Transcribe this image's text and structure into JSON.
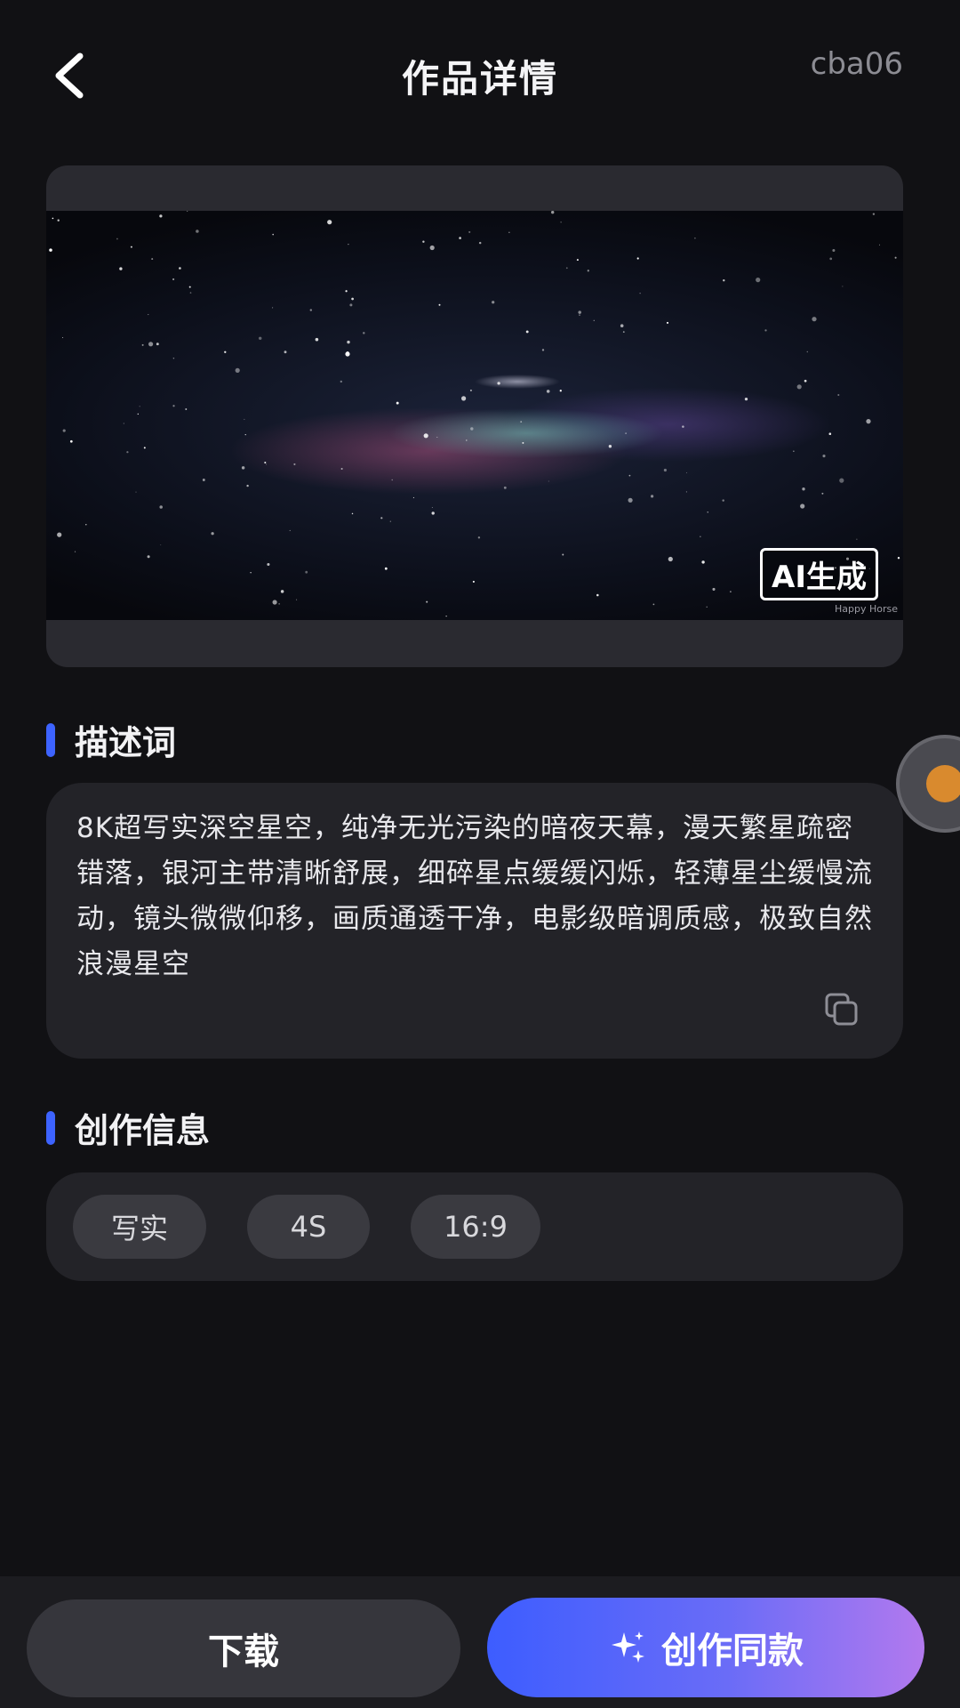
{
  "header": {
    "back_icon": "chevron-left-icon",
    "title": "作品详情",
    "user_id": "cba06"
  },
  "media": {
    "ai_badge": "AI生成",
    "watermark": "Happy Horse"
  },
  "description": {
    "heading": "描述词",
    "prompt": "8K超写实深空星空，纯净无光污染的暗夜天幕，漫天繁星疏密错落，银河主带清晰舒展，细碎星点缓缓闪烁，轻薄星尘缓慢流动，镜头微微仰移，画质通透干净，电影级暗调质感，极致自然浪漫星空",
    "copy_icon": "copy-icon"
  },
  "creation_info": {
    "heading": "创作信息",
    "tags": [
      "写实",
      "4S",
      "16:9"
    ]
  },
  "actions": {
    "download_label": "下载",
    "create_same_label": "创作同款",
    "sparkle_icon": "sparkle-icon"
  },
  "colors": {
    "accent": "#3d63ff",
    "background": "#111114",
    "card": "#232328",
    "gradient_start": "#3d5dff",
    "gradient_end": "#b279ee"
  }
}
